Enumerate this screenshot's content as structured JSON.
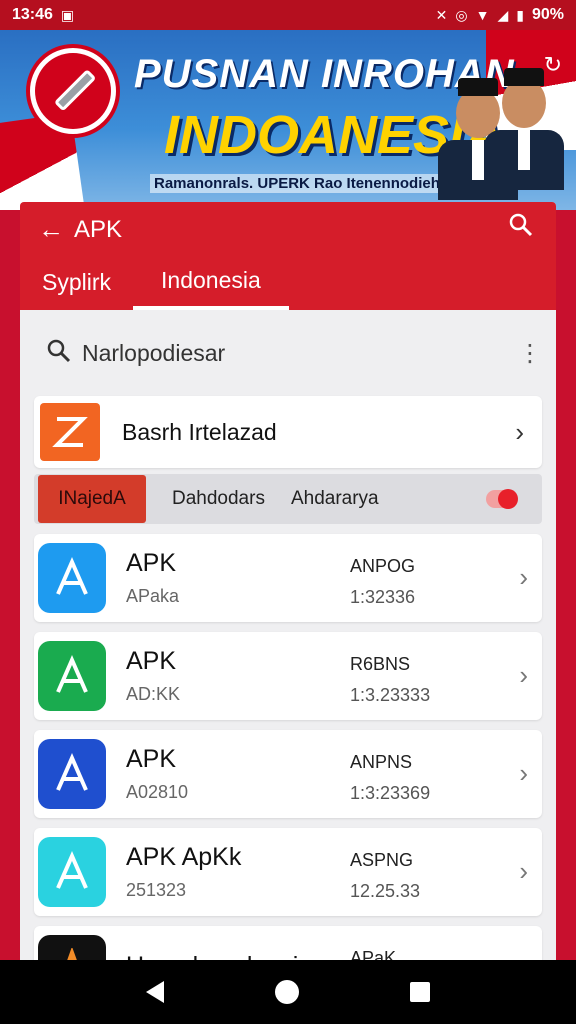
{
  "status_bar": {
    "time": "13:46",
    "battery": "90%",
    "icons": [
      "photo-icon",
      "mute-icon",
      "data-saver-icon",
      "wifi-icon",
      "signal-icon",
      "battery-icon"
    ]
  },
  "banner": {
    "title_line1": "PUSNAN INROHAN",
    "title_line2": "INDOANESIA",
    "subtitle": "Ramanonrals. UPERK Rao Itenennodiehte"
  },
  "appbar": {
    "title": "APK",
    "tabs": [
      {
        "label": "Syplirk",
        "active": false
      },
      {
        "label": "Indonesia",
        "active": true
      }
    ]
  },
  "search": {
    "text": "Narlopodiesar"
  },
  "feature": {
    "label": "Basrh Irtelazad"
  },
  "filters": {
    "chip": "INajedA",
    "options": [
      "Dahdodars",
      "Ahdararya"
    ],
    "toggle_on": true
  },
  "apps": [
    {
      "name": "APK",
      "sub": "APaka",
      "meta1": "ANPOG",
      "meta2": "1:32336",
      "color": "#1e9bf0"
    },
    {
      "name": "APK",
      "sub": "AD:KK",
      "meta1": "R6BNS",
      "meta2": "1:3.23333",
      "color": "#1aab4f"
    },
    {
      "name": "APK",
      "sub": "A02810",
      "meta1": "ANPNS",
      "meta2": "1:3:23369",
      "color": "#1f4fcf"
    },
    {
      "name": "APK ApKk",
      "sub": "251323",
      "meta1": "ASPNG",
      "meta2": "12.25.33",
      "color": "#2ad2e0"
    },
    {
      "name": "Uamalamelgasir.",
      "sub": "",
      "meta1": "APaK",
      "meta2": "",
      "color": "#111111"
    }
  ],
  "colors": {
    "primary_red": "#d51d2a",
    "status_red": "#b50f1f"
  }
}
